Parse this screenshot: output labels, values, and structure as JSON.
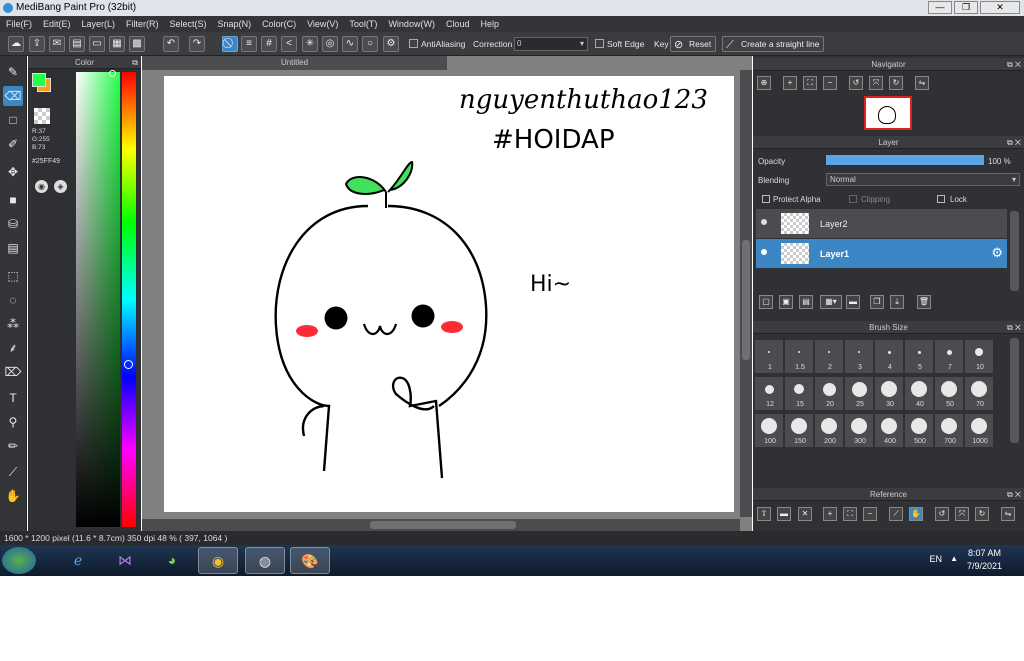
{
  "window": {
    "title": "MediBang Paint Pro (32bit)"
  },
  "menu": [
    "File(F)",
    "Edit(E)",
    "Layer(L)",
    "Filter(R)",
    "Select(S)",
    "Snap(N)",
    "Color(C)",
    "View(V)",
    "Tool(T)",
    "Window(W)",
    "Cloud",
    "Help"
  ],
  "toolbar": {
    "antialias_label": "AntiAliasing",
    "correction_label": "Correction",
    "correction_value": "0",
    "soft_edge_label": "Soft Edge",
    "key_label": "Key",
    "reset_label": "Reset",
    "straight_line_label": "Create a straight line"
  },
  "color_panel": {
    "title": "Color",
    "r": "R:37",
    "g": "G:255",
    "b": "B:73",
    "hex": "#25FF49",
    "fg_color": "#25ff49",
    "bg_color": "#f6a21a"
  },
  "canvas": {
    "tab": "Untitled",
    "text_name": "nguyenthuthao123",
    "text_tag": "#HOIDAP",
    "text_hi": "Hi~"
  },
  "navigator": {
    "title": "Navigator"
  },
  "layer_panel": {
    "title": "Layer",
    "opacity_label": "Opacity",
    "opacity_value": "100 %",
    "opacity_fraction": 1.0,
    "blending_label": "Blending",
    "blending_value": "Normal",
    "protect_alpha": "Protect Alpha",
    "clipping": "Clipping",
    "lock": "Lock",
    "layers": [
      {
        "name": "Layer2",
        "selected": false
      },
      {
        "name": "Layer1",
        "selected": true
      }
    ]
  },
  "brush_panel": {
    "title": "Brush Size",
    "sizes": [
      "1",
      "1.5",
      "2",
      "3",
      "4",
      "5",
      "7",
      "10",
      "12",
      "15",
      "20",
      "25",
      "30",
      "40",
      "50",
      "70",
      "100",
      "150",
      "200",
      "300",
      "400",
      "500",
      "700",
      "1000"
    ]
  },
  "reference": {
    "title": "Reference"
  },
  "status": "1600 * 1200 pixel   (11.6 * 8.7cm)   350 dpi   48 %   ( 397, 1064 )",
  "taskbar": {
    "lang": "EN",
    "time": "8:07 AM",
    "date": "7/9/2021"
  }
}
